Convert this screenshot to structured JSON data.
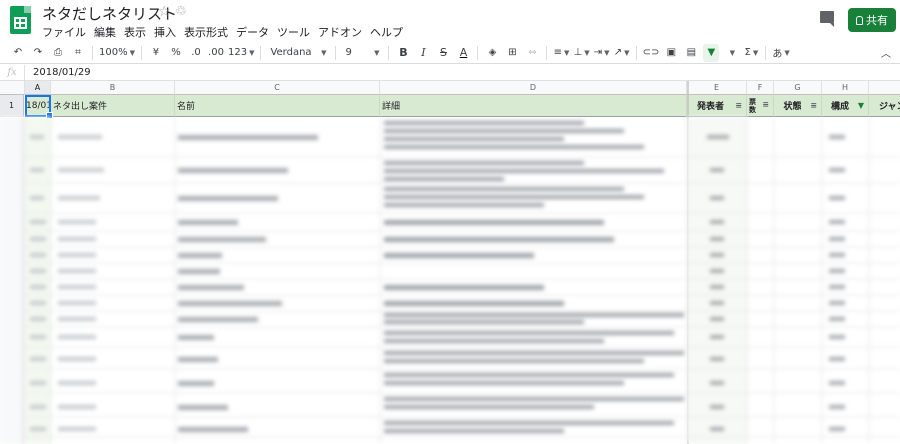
{
  "app": {
    "doc_title": "ネタだしネタリスト",
    "share_label": "共有"
  },
  "menu": [
    "ファイル",
    "編集",
    "表示",
    "挿入",
    "表示形式",
    "データ",
    "ツール",
    "アドオン",
    "ヘルプ"
  ],
  "toolbar": {
    "zoom": "100%",
    "currency": "¥",
    "percent": "%",
    "decimal_decrease": ".0",
    "decimal_increase": ".00",
    "number_format": "123",
    "font": "Verdana",
    "font_size": "9",
    "bold": "B",
    "italic": "I",
    "strike": "S",
    "text_color": "A",
    "input_tools": "あ"
  },
  "formula_bar": {
    "fx": "fx",
    "value": "2018/01/29"
  },
  "columns": [
    "A",
    "B",
    "C",
    "D",
    "E",
    "F",
    "G",
    "H"
  ],
  "header_row": {
    "row_number": "1",
    "cells": [
      "18/01/",
      "ネタ出し案件",
      "名前",
      "詳細",
      "発表者",
      "票数",
      "状態",
      "構成",
      "ジャン"
    ]
  }
}
